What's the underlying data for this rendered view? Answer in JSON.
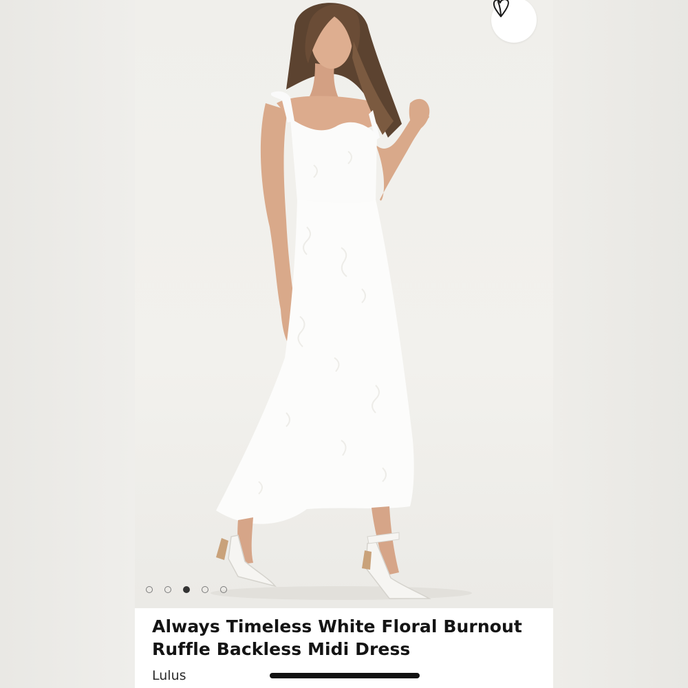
{
  "product": {
    "title_line1": "Always Timeless White Floral Burnout",
    "title_line2": "Ruffle Backless Midi Dress",
    "brand": "Lulus"
  },
  "gallery": {
    "image_count": 5,
    "active_index": 2,
    "image_alt": "Model wearing white floral burnout midi dress with white strappy heels"
  },
  "icons": {
    "favorite": "heart-icon"
  },
  "colors": {
    "dress": "#ffffff",
    "background": "#efeeea",
    "dot_active": "#333333",
    "title_text": "#141414"
  }
}
